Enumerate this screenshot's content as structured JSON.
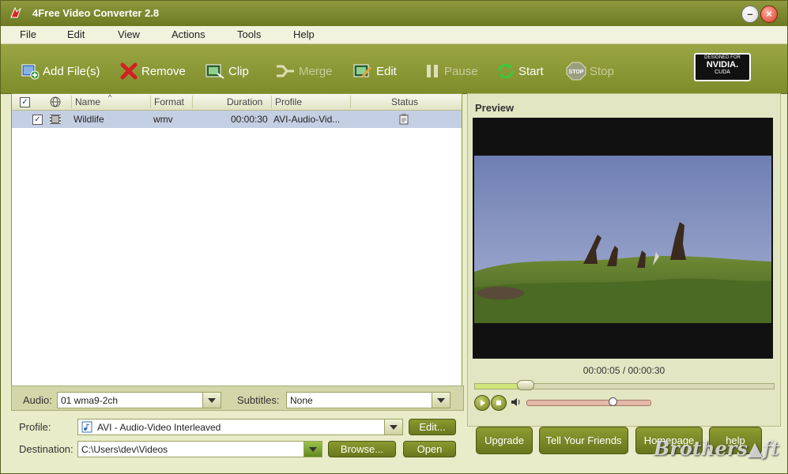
{
  "window": {
    "title": "4Free Video Converter 2.8"
  },
  "menu": [
    "File",
    "Edit",
    "View",
    "Actions",
    "Tools",
    "Help"
  ],
  "toolbar": {
    "add_files": "Add File(s)",
    "remove": "Remove",
    "clip": "Clip",
    "merge": "Merge",
    "edit": "Edit",
    "pause": "Pause",
    "start": "Start",
    "stop": "Stop"
  },
  "badge": {
    "line1": "DESIGNED FOR",
    "line2": "NVIDIA.",
    "line3": "CUDA"
  },
  "file_list": {
    "columns": {
      "name": "Name",
      "format": "Format",
      "duration": "Duration",
      "profile": "Profile",
      "status": "Status"
    },
    "rows": [
      {
        "checked": true,
        "name": "Wildlife",
        "format": "wmv",
        "duration": "00:00:30",
        "profile": "AVI-Audio-Vid..."
      }
    ]
  },
  "audio": {
    "label": "Audio:",
    "value": "01 wma9-2ch"
  },
  "subtitles": {
    "label": "Subtitles:",
    "value": "None"
  },
  "profile": {
    "label": "Profile:",
    "value": "AVI - Audio-Video Interleaved",
    "edit_button": "Edit..."
  },
  "destination": {
    "label": "Destination:",
    "value": "C:\\Users\\dev\\Videos",
    "browse_button": "Browse...",
    "open_button": "Open"
  },
  "preview": {
    "title": "Preview",
    "time": "00:00:05 / 00:00:30",
    "progress": 0.17,
    "volume": 0.7
  },
  "bottom_buttons": {
    "upgrade": "Upgrade",
    "tell_friends": "Tell Your Friends",
    "homepage": "Homepage",
    "help": "help"
  },
  "watermark": "Brothers▲ft",
  "colors": {
    "accent": "#7e8c2a",
    "selection": "#c5cfe3"
  }
}
